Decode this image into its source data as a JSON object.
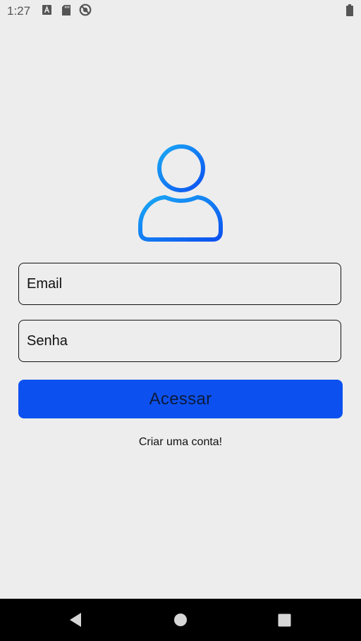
{
  "status_bar": {
    "time": "1:27",
    "icons": [
      "font-a-icon",
      "sd-card-icon",
      "no-sync-icon",
      "battery-icon"
    ]
  },
  "avatar": {
    "icon": "user-icon",
    "gradient_start": "#1aa9f5",
    "gradient_end": "#0c51f0"
  },
  "form": {
    "email_placeholder": "Email",
    "email_value": "",
    "password_placeholder": "Senha",
    "password_value": "",
    "submit_label": "Acessar",
    "create_account_label": "Criar uma conta!"
  },
  "nav_bar": {
    "buttons": [
      "back-icon",
      "home-icon",
      "recent-apps-icon"
    ]
  },
  "colors": {
    "background": "#ededed",
    "accent": "#0c51f0",
    "nav_background": "#000000"
  }
}
